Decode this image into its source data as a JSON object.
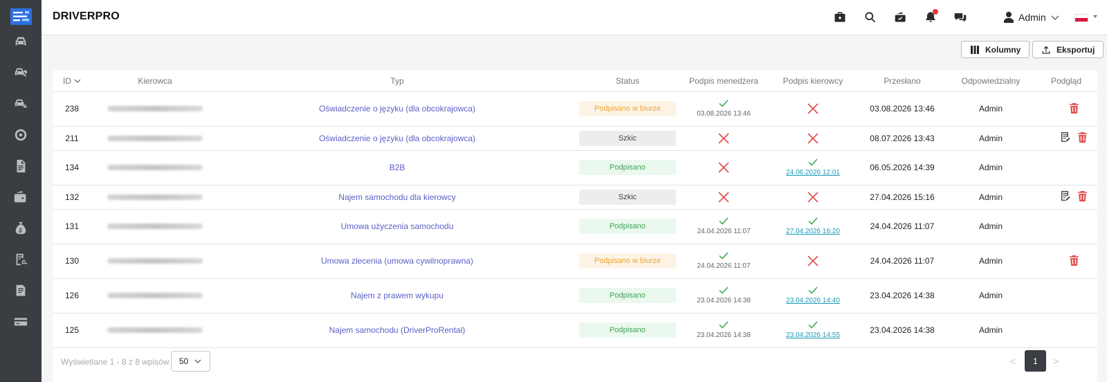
{
  "app": {
    "brand": "DRIVERPRO"
  },
  "header": {
    "user_name": "Admin",
    "icons": [
      "briefcase-icon",
      "search-icon",
      "wallet-check-icon",
      "bell-icon",
      "chat-icon"
    ],
    "notification_badge_color": "#e53935",
    "flag": "poland-flag"
  },
  "sidebar": {
    "items": [
      "car-icon",
      "car-wrench-icon",
      "car-warning-icon",
      "tire-icon",
      "document-icon",
      "wallet-icon",
      "money-bag-icon",
      "car-doc-icon",
      "receipt-icon",
      "credit-card-icon"
    ]
  },
  "toolbar": {
    "columns_label": "Kolumny",
    "export_label": "Eksportuj"
  },
  "table": {
    "headers": {
      "id": "ID",
      "driver": "Kierowca",
      "type": "Typ",
      "status": "Status",
      "manager_sig": "Podpis menedżera",
      "driver_sig": "Podpis kierowcy",
      "sent": "Przesłano",
      "responsible": "Odpowiedzialny",
      "preview": "Podgląd"
    },
    "rows": [
      {
        "id": "238",
        "type": "Oświadczenie o języku (dla obcokrajowca)",
        "status": "Podpisano w biurze",
        "manager_date": "03.08.2026 13:46",
        "driver_date": "",
        "sent": "03.08.2026 13:46",
        "responsible": "Admin"
      },
      {
        "id": "211",
        "type": "Oświadczenie o języku (dla obcokrajowca)",
        "status": "Szkic",
        "manager_date": "",
        "driver_date": "",
        "sent": "08.07.2026 13:43",
        "responsible": "Admin"
      },
      {
        "id": "134",
        "type": "B2B",
        "status": "Podpisano",
        "manager_date": "",
        "driver_date": "24.06.2026 12:01",
        "sent": "06.05.2026 14:39",
        "responsible": "Admin"
      },
      {
        "id": "132",
        "type": "Najem samochodu dla kierowcy",
        "status": "Szkic",
        "manager_date": "",
        "driver_date": "",
        "sent": "27.04.2026 15:16",
        "responsible": "Admin"
      },
      {
        "id": "131",
        "type": "Umowa użyczenia samochodu",
        "status": "Podpisano",
        "manager_date": "24.04.2026 11:07",
        "driver_date": "27.04.2026 16:20",
        "sent": "24.04.2026 11:07",
        "responsible": "Admin"
      },
      {
        "id": "130",
        "type": "Umowa zlecenia (umowa cywilnoprawna)",
        "status": "Podpisano w biurze",
        "manager_date": "24.04.2026 11:07",
        "driver_date": "",
        "sent": "24.04.2026 11:07",
        "responsible": "Admin"
      },
      {
        "id": "126",
        "type": "Najem z prawem wykupu",
        "status": "Podpisano",
        "manager_date": "23.04.2026 14:38",
        "driver_date": "23.04.2026 14:40",
        "sent": "23.04.2026 14:38",
        "responsible": "Admin"
      },
      {
        "id": "125",
        "type": "Najem samochodu (DriverProRental)",
        "status": "Podpisano",
        "manager_date": "23.04.2026 14:38",
        "driver_date": "23.04.2026 14:55",
        "sent": "23.04.2026 14:38",
        "responsible": "Admin"
      }
    ]
  },
  "footer": {
    "summary": "Wyświetlane 1 - 8 z 8 wpisów",
    "page_size": "50",
    "current_page": "1",
    "prev": "<",
    "next": ">"
  },
  "colors": {
    "sidebar_bg": "#3a3d42",
    "link": "#5b5fc7",
    "success": "#3aa456",
    "danger": "#e04b4b",
    "warning": "#f0a430"
  }
}
